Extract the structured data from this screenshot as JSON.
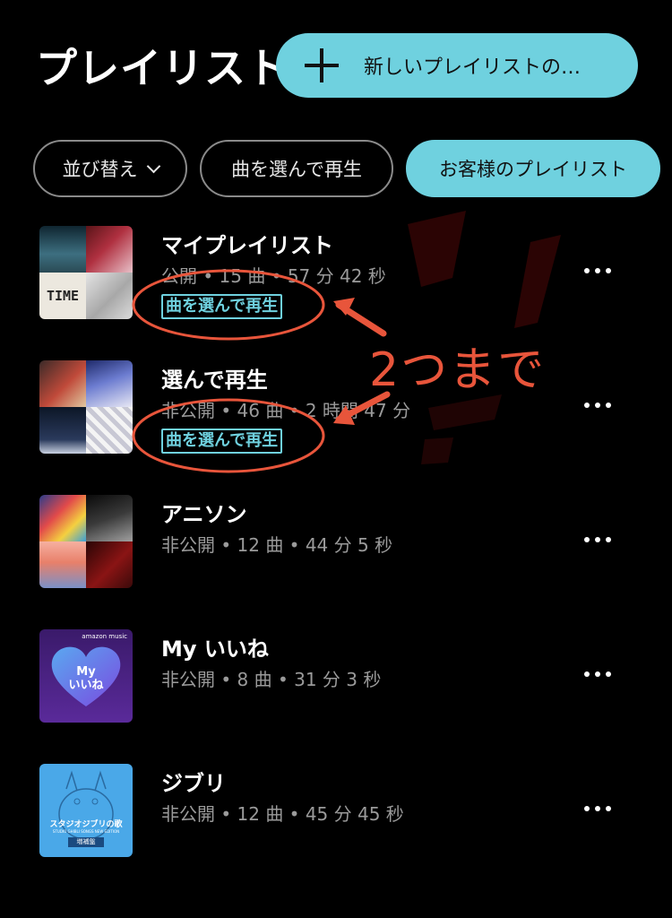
{
  "header": {
    "title": "プレイリスト",
    "new_playlist_label": "新しいプレイリストの…"
  },
  "chips": [
    {
      "label": "並び替え",
      "has_chevron": true,
      "active": false
    },
    {
      "label": "曲を選んで再生",
      "active": false
    },
    {
      "label": "お客様のプレイリスト",
      "active": true
    }
  ],
  "playlists": [
    {
      "title": "マイプレイリスト",
      "meta": "公開 • 15 曲 • 57 分 42 秒",
      "badge": "曲を選んで再生"
    },
    {
      "title": "選んで再生",
      "meta": "非公開 • 46 曲 • 2 時間 47 分",
      "badge": "曲を選んで再生"
    },
    {
      "title": "アニソン",
      "meta": "非公開 • 12 曲 • 44 分 5 秒",
      "badge": ""
    },
    {
      "title": "My いいね",
      "meta": "非公開 • 8 曲 • 31 分 3 秒",
      "badge": ""
    },
    {
      "title": "ジブリ",
      "meta": "非公開 • 12 曲 • 45 分 45 秒",
      "badge": ""
    }
  ],
  "art": {
    "my_likes": {
      "brand": "amazon music",
      "line1": "My",
      "line2": "いいね"
    },
    "ghibli": {
      "title": "スタジオジブリの歌",
      "subtitle": "STUDIO GHIBLI SONGS NEW EDITION",
      "tag": "増補盤"
    },
    "time_text": "TIME"
  },
  "annotation": {
    "text": "2つまで",
    "color": "#e8553b"
  },
  "colors": {
    "accent": "#6fd1df",
    "background": "#000000",
    "meta": "#9a9a9a"
  }
}
